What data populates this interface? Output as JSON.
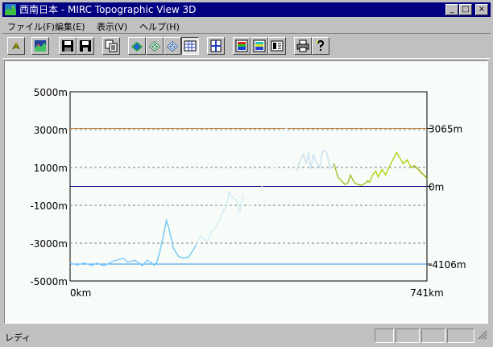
{
  "window": {
    "title": "西南日本 - MIRC Topographic View 3D",
    "min_label": "_",
    "max_label": "□",
    "close_label": "×"
  },
  "menu": [
    "ファイル(F)",
    "編集(E)",
    "表示(V)",
    "ヘルプ(H)"
  ],
  "toolbar": {
    "buttons": [
      {
        "icon": "pointer-icon",
        "pressed": false
      },
      {
        "icon": "landscape-image-icon",
        "pressed": false
      },
      {
        "icon": "save-floppy-icon",
        "pressed": false
      },
      {
        "icon": "save-as-floppy-icon",
        "pressed": false
      },
      {
        "icon": "copy-icon",
        "pressed": false
      },
      {
        "icon": "3d-view-icon",
        "pressed": false
      },
      {
        "icon": "3d-mesh-icon",
        "pressed": false
      },
      {
        "icon": "3d-wireframe-icon",
        "pressed": false
      },
      {
        "icon": "grid-view-icon",
        "pressed": true
      },
      {
        "icon": "cross-section-icon",
        "pressed": false
      },
      {
        "icon": "color-bar-icon",
        "pressed": false
      },
      {
        "icon": "color-bar-alt-icon",
        "pressed": false
      },
      {
        "icon": "legend-icon",
        "pressed": false
      },
      {
        "icon": "print-icon",
        "pressed": false
      },
      {
        "icon": "help-icon",
        "pressed": false
      }
    ]
  },
  "status": {
    "text": "レディ"
  },
  "chart_data": {
    "type": "line",
    "title": "",
    "xlabel": "",
    "ylabel": "",
    "xlim": [
      0,
      741
    ],
    "ylim": [
      -5000,
      5000
    ],
    "x_tick_labels": [
      "0km",
      "741km"
    ],
    "y_tick_labels": [
      "5000m",
      "3000m",
      "1000m",
      "-1000m",
      "-3000m",
      "-5000m"
    ],
    "y_ticks": [
      5000,
      3000,
      1000,
      -1000,
      -3000,
      -5000
    ],
    "grid": "dashed horizontal lines",
    "reference_lines": [
      {
        "value": 3065,
        "label": "3065m",
        "color": "#c08040"
      },
      {
        "value": 0,
        "label": "0m",
        "color": "#000080"
      },
      {
        "value": -4106,
        "label": "-4106m",
        "color": "#3090e0"
      }
    ],
    "series": [
      {
        "x": [
          0,
          15,
          30,
          45,
          55,
          70,
          90,
          110,
          120,
          135,
          150,
          160,
          170,
          175,
          180,
          185,
          192,
          200,
          205,
          215,
          225,
          235,
          245,
          255,
          262,
          270,
          285,
          295,
          302,
          310,
          318,
          325,
          330,
          338,
          345,
          352,
          360,
          368,
          375,
          385,
          392,
          400,
          410,
          420,
          430,
          440,
          450,
          460,
          470,
          478,
          485,
          490,
          495,
          500,
          505,
          510,
          518,
          525,
          533,
          540,
          548,
          556,
          563,
          571,
          577,
          582,
          588,
          593,
          598,
          605,
          612,
          618,
          622,
          628,
          635,
          640,
          648,
          655,
          662,
          670,
          678,
          685,
          692,
          700,
          708,
          715,
          723,
          730,
          735,
          741
        ],
        "y": [
          -4050,
          -4150,
          -4050,
          -4180,
          -4050,
          -4200,
          -3950,
          -3800,
          -4000,
          -3900,
          -4200,
          -3900,
          -4050,
          -4180,
          -4000,
          -3600,
          -2800,
          -1800,
          -2200,
          -3300,
          -3700,
          -3800,
          -3750,
          -3400,
          -3100,
          -2600,
          -2900,
          -2300,
          -2200,
          -1800,
          -1300,
          -1000,
          -300,
          -600,
          -700,
          -1400,
          -400,
          -500,
          -1100,
          -1300,
          -600,
          100,
          400,
          800,
          1500,
          2900,
          3065,
          1600,
          800,
          1400,
          1700,
          1200,
          1800,
          900,
          1700,
          1300,
          1000,
          1900,
          1800,
          900,
          1200,
          500,
          300,
          100,
          200,
          600,
          300,
          150,
          100,
          50,
          150,
          300,
          200,
          600,
          800,
          500,
          900,
          600,
          1000,
          1400,
          1800,
          1500,
          1200,
          1400,
          1000,
          1100,
          900,
          700,
          600,
          400
        ]
      }
    ],
    "segment_colors": [
      "#80c8ff",
      "#6ec8f0",
      "#d0ecf8",
      "#f0f8ff",
      "#c8e0f0",
      "#a0c020",
      "#b0d010",
      "#a0b000"
    ]
  }
}
